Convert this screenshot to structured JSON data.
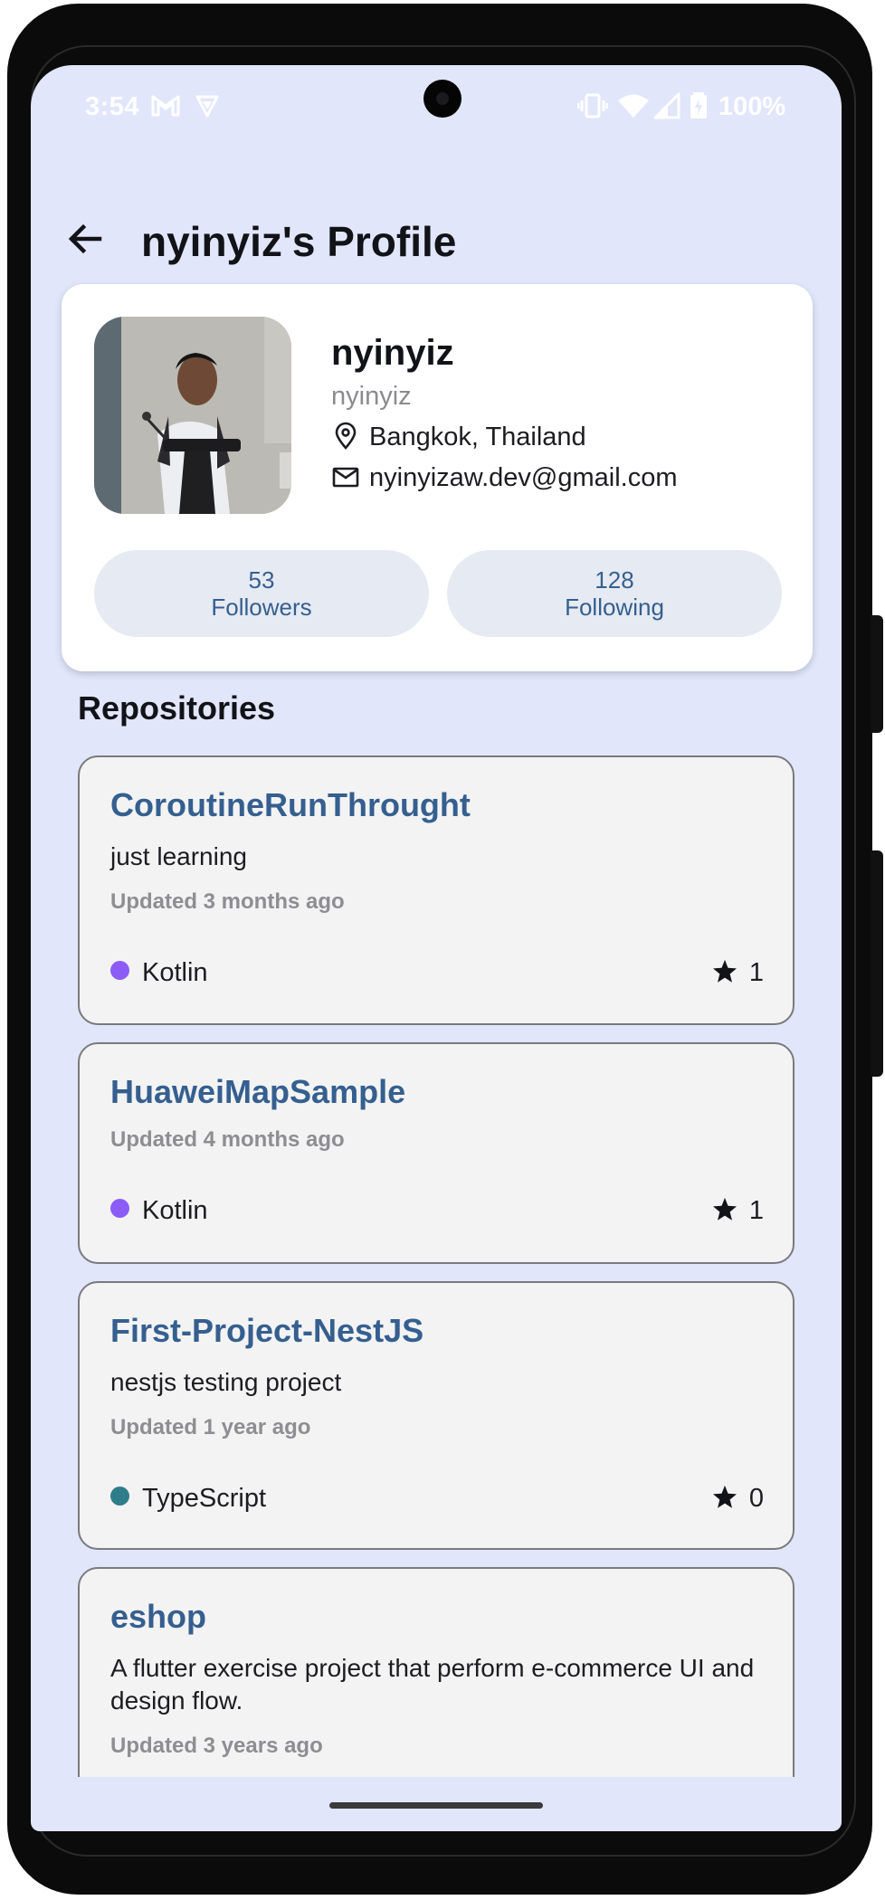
{
  "status_bar": {
    "time": "3:54",
    "battery": "100%",
    "icons": [
      "gmail-icon",
      "shield-icon",
      "vibrate-icon",
      "wifi-icon",
      "signal-icon",
      "battery-icon"
    ]
  },
  "topbar": {
    "back_icon": "arrow-back-icon",
    "title": "nyinyiz's Profile"
  },
  "profile": {
    "name": "nyinyiz",
    "login": "nyinyiz",
    "location": "Bangkok, Thailand",
    "email": "nyinyizaw.dev@gmail.com",
    "followers": {
      "count": "53",
      "label": "Followers"
    },
    "following": {
      "count": "128",
      "label": "Following"
    }
  },
  "repositories": {
    "title": "Repositories",
    "items": [
      {
        "name": "CoroutineRunThrought",
        "description": "just learning",
        "updated": "Updated 3 months ago",
        "language": "Kotlin",
        "language_color": "#8b5cf6",
        "stars": "1"
      },
      {
        "name": "HuaweiMapSample",
        "description": "",
        "updated": "Updated 4 months ago",
        "language": "Kotlin",
        "language_color": "#8b5cf6",
        "stars": "1"
      },
      {
        "name": "First-Project-NestJS",
        "description": "nestjs testing project",
        "updated": "Updated 1 year ago",
        "language": "TypeScript",
        "language_color": "#2f7d8a",
        "stars": "0"
      },
      {
        "name": "eshop",
        "description": "A flutter exercise project that perform e-commerce UI and design flow.",
        "updated": "Updated 3 years ago",
        "language": "",
        "language_color": "",
        "stars": ""
      }
    ]
  },
  "colors": {
    "background": "#e1e6fb",
    "accent": "#355f8f",
    "card": "#ffffff",
    "repo_card": "#f3f3f4"
  }
}
